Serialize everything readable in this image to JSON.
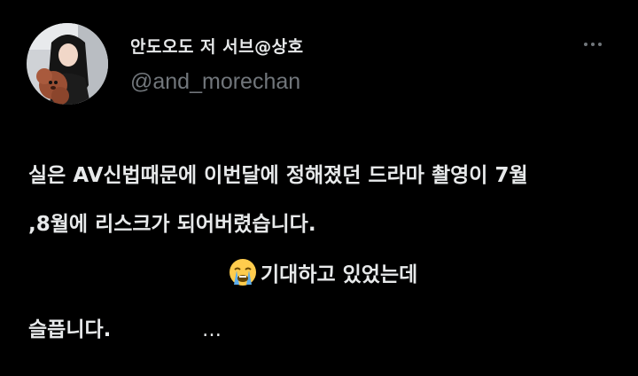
{
  "author": {
    "display_name": "안도오도 저 서브@상호",
    "handle": "@and_morechan",
    "avatar_icon": "profile-photo"
  },
  "more_menu": {
    "icon": "more-horizontal-icon"
  },
  "tweet": {
    "line1": "실은 AV신법때문에 이번달에 정해졌던 드라마 촬영이 7월",
    "line2": ",8월에 리스크가 되어버렸습니다.",
    "line3_emoji": "loudly-crying-face",
    "line3_text": "기대하고 있었는데",
    "line4": "슬픕니다.",
    "line5": "…"
  },
  "colors": {
    "background": "#000000",
    "text_primary": "#e7e9ea",
    "text_secondary": "#71767b"
  }
}
